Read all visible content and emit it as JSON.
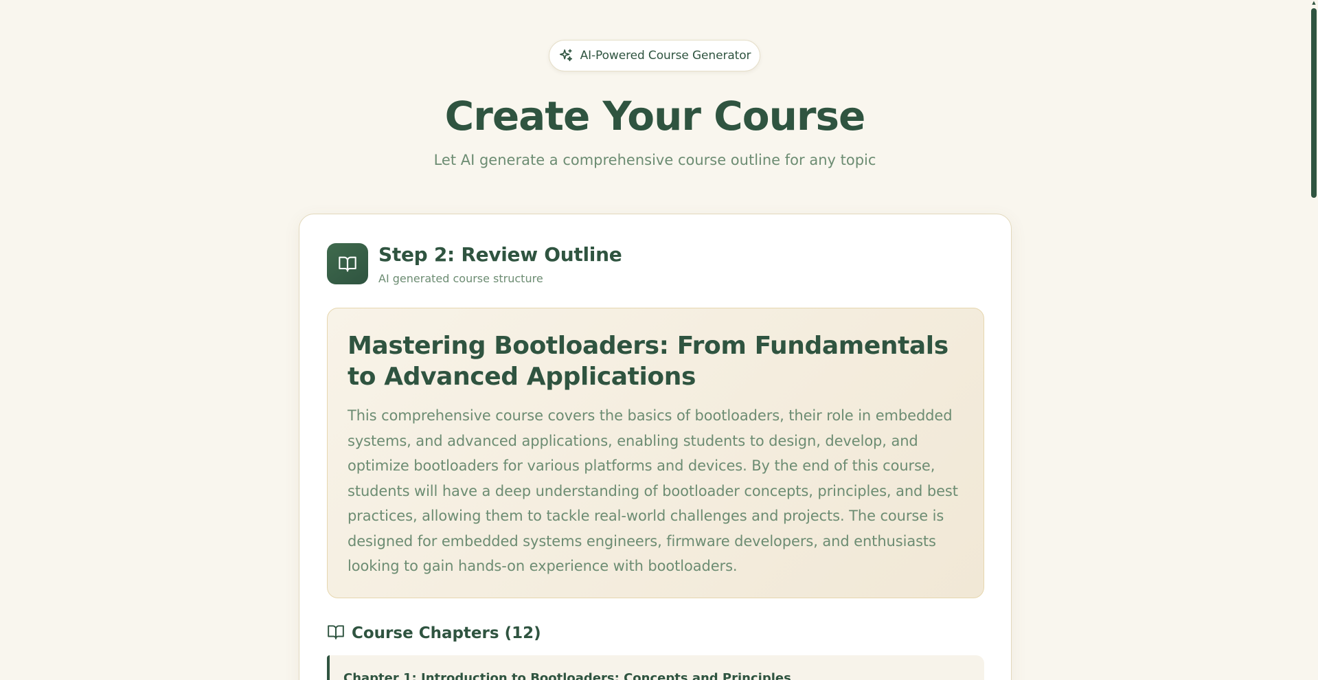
{
  "header": {
    "badge_label": "AI-Powered Course Generator",
    "badge_icon": "sparkles-icon",
    "title": "Create Your Course",
    "subtitle": "Let AI generate a comprehensive course outline for any topic"
  },
  "step": {
    "icon": "book-open-icon",
    "title": "Step 2: Review Outline",
    "subtitle": "AI generated course structure"
  },
  "outline": {
    "course_title": "Mastering Bootloaders: From Fundamentals to Advanced Applications",
    "description": "This comprehensive course covers the basics of bootloaders, their role in embedded systems, and advanced applications, enabling students to design, develop, and optimize bootloaders for various platforms and devices. By the end of this course, students will have a deep understanding of bootloader concepts, principles, and best practices, allowing them to tackle real-world challenges and projects. The course is designed for embedded systems engineers, firmware developers, and enthusiasts looking to gain hands-on experience with bootloaders."
  },
  "chapters": {
    "icon": "book-open-icon",
    "heading": "Course Chapters (12)",
    "items": [
      {
        "title": "Chapter 1: Introduction to Bootloaders: Concepts and Principles"
      }
    ]
  },
  "colors": {
    "background": "#f9f6ee",
    "primary": "#2f5440",
    "muted_text": "#6c8c72",
    "card_border": "#e2d8bb",
    "outline_bg": "#f4ede0"
  }
}
